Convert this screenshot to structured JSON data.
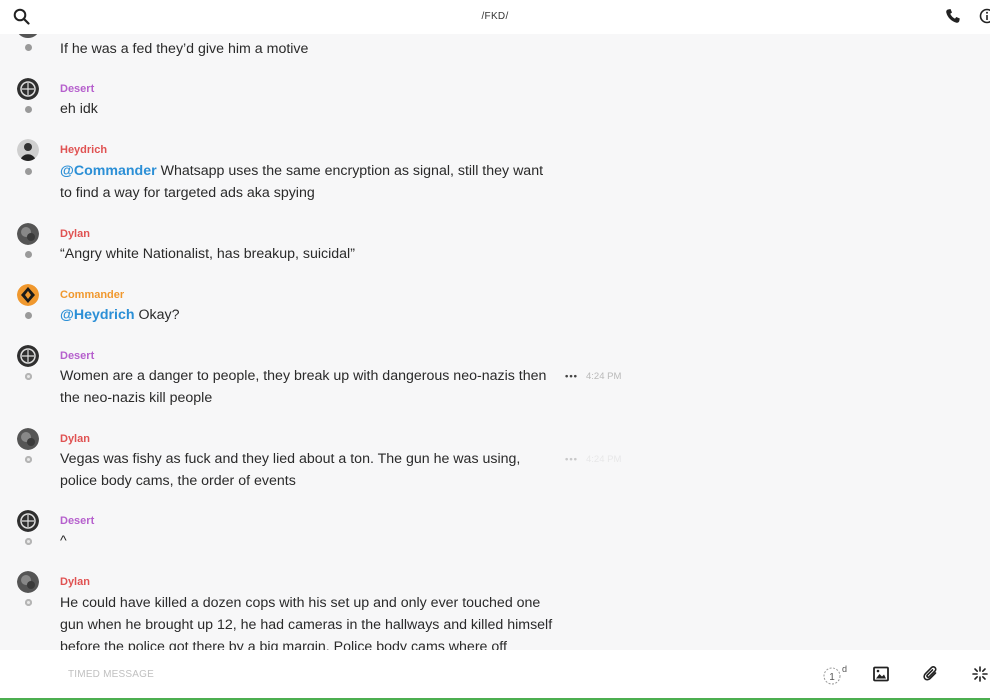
{
  "header": {
    "title": "/FKD/",
    "search_icon": "search-icon",
    "call_icon": "phone-icon",
    "info_icon": "info-icon"
  },
  "colors": {
    "desert": "#b660cd",
    "heydrich": "#e05252",
    "dylan": "#e05252",
    "commander": "#f0982e",
    "mention": "#2b8fd6",
    "composer_border": "#4caf50"
  },
  "messages": [
    {
      "sender": "",
      "text": "If he was a fed they’d give him a motive"
    },
    {
      "sender": "Desert",
      "text": "eh idk"
    },
    {
      "sender": "Heydrich",
      "mention": "@Commander",
      "text": " Whatsapp uses the same encryption as signal, still they want to find a way for targeted ads aka spying"
    },
    {
      "sender": "Dylan",
      "text": "“Angry white Nationalist, has breakup, suicidal”"
    },
    {
      "sender": "Commander",
      "mention": "@Heydrich",
      "text": " Okay?"
    },
    {
      "sender": "Desert",
      "text": "Women are a danger to people, they break up with dangerous neo-nazis then the neo-nazis kill people",
      "more": "•••",
      "time": "4:24 PM"
    },
    {
      "sender": "Dylan",
      "text": "Vegas was fishy as fuck and they lied about a ton. The gun he was using, police body cams, the order of events",
      "more": "•••",
      "time": "4:24 PM"
    },
    {
      "sender": "Desert",
      "text": "^"
    },
    {
      "sender": "Dylan",
      "text": "He could have killed a dozen cops with his set up and only ever touched one gun when he brought up 12, he had cameras in the hallways and killed himself before the police got there by a big margin. Police body cams where off"
    }
  ],
  "composer": {
    "placeholder": "TIMED MESSAGE",
    "timer_value": "1",
    "timer_unit": "d",
    "icons": [
      "timer-icon",
      "image-icon",
      "attachment-icon",
      "sparkle-icon"
    ]
  }
}
